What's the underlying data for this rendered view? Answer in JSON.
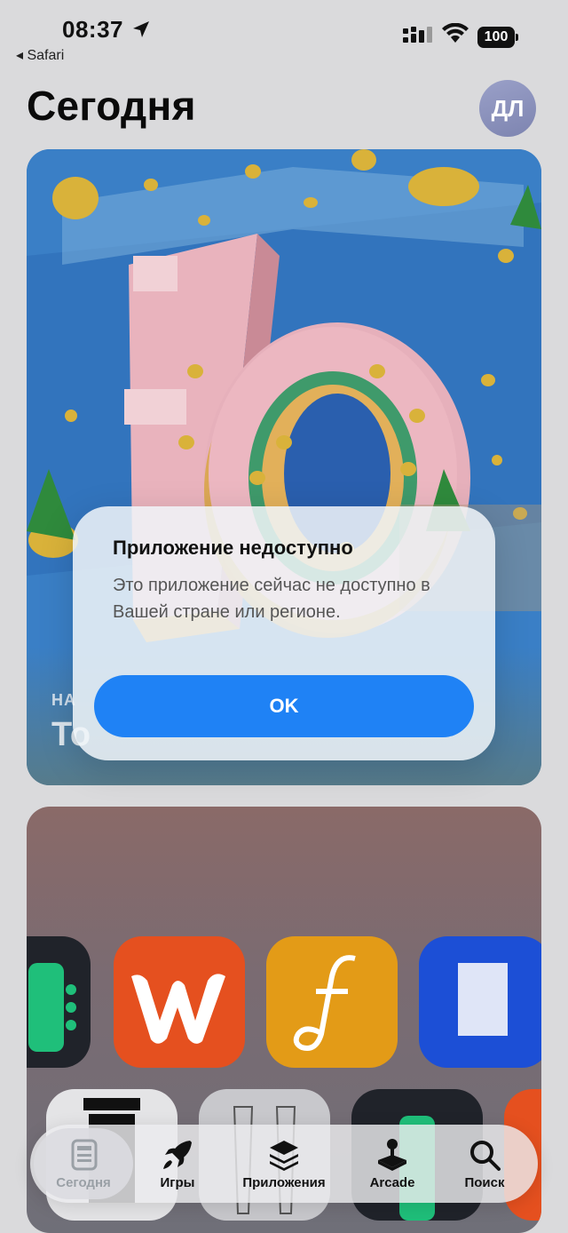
{
  "status_bar": {
    "time": "08:37",
    "back_app": "Safari",
    "battery": "100"
  },
  "header": {
    "title": "Сегодня",
    "avatar_initials": "ДЛ"
  },
  "featured_card": {
    "tag": "НА",
    "headline": "То"
  },
  "alert": {
    "title": "Приложение недоступно",
    "message": "Это приложение сейчас не доступно в Вашей стране или регионе.",
    "ok_label": "OK"
  },
  "tab_bar": {
    "tabs": [
      {
        "label": "Сегодня",
        "icon": "today-icon",
        "active": true
      },
      {
        "label": "Игры",
        "icon": "rocket-icon",
        "active": false
      },
      {
        "label": "Приложения",
        "icon": "layers-icon",
        "active": false
      },
      {
        "label": "Arcade",
        "icon": "joystick-icon",
        "active": false
      },
      {
        "label": "Поиск",
        "icon": "search-icon",
        "active": false
      }
    ]
  },
  "colors": {
    "accent": "#1f82f5",
    "avatar": "#8d93bd"
  }
}
